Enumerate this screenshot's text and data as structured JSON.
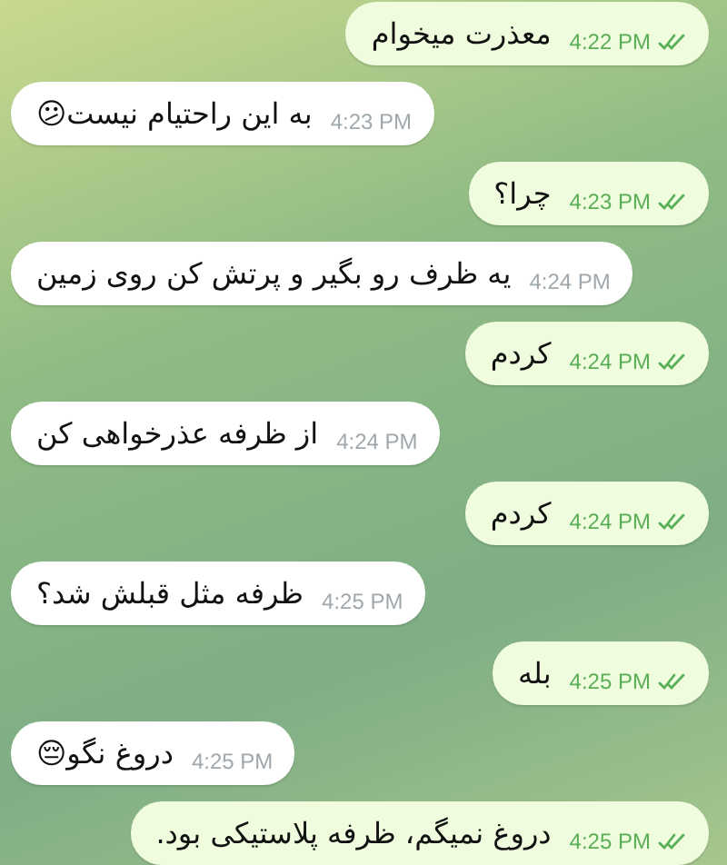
{
  "messages": [
    {
      "kind": "outgoing",
      "text": "معذرت میخوام",
      "time": "4:22 PM",
      "read": true
    },
    {
      "kind": "incoming",
      "text": "به این راحتیام نیست😕",
      "time": "4:23 PM"
    },
    {
      "kind": "outgoing",
      "text": "چرا؟",
      "time": "4:23 PM",
      "read": true
    },
    {
      "kind": "incoming",
      "text": "یه ظرف رو بگیر و پرتش کن روی زمین",
      "time": "4:24 PM"
    },
    {
      "kind": "outgoing",
      "text": "کردم",
      "time": "4:24 PM",
      "read": true
    },
    {
      "kind": "incoming",
      "text": "از ظرفه عذرخواهی کن",
      "time": "4:24 PM"
    },
    {
      "kind": "outgoing",
      "text": "کردم",
      "time": "4:24 PM",
      "read": true
    },
    {
      "kind": "incoming",
      "text": "ظرفه مثل قبلش شد؟",
      "time": "4:25 PM"
    },
    {
      "kind": "outgoing",
      "text": "بله",
      "time": "4:25 PM",
      "read": true
    },
    {
      "kind": "incoming",
      "text": "دروغ نگو😔",
      "time": "4:25 PM"
    },
    {
      "kind": "outgoing",
      "text": "دروغ نمیگم، ظرفه پلاستیکی بود.",
      "time": "4:25 PM",
      "read": true
    }
  ]
}
